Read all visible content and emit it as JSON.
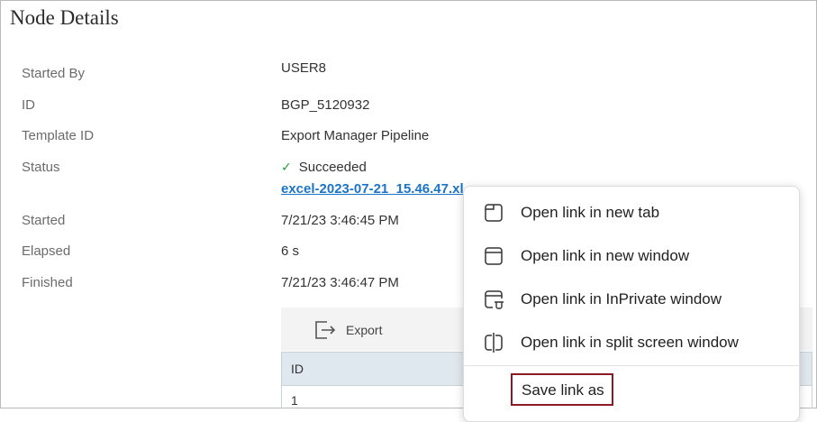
{
  "panel": {
    "title": "Node Details"
  },
  "details": [
    {
      "label": "Started By",
      "value": "USER8"
    },
    {
      "label": "ID",
      "value": "BGP_5120932"
    },
    {
      "label": "Template ID",
      "value": "Export Manager Pipeline"
    },
    {
      "label": "Status",
      "value": "Succeeded",
      "icon": "check-icon"
    },
    {
      "label": "Started",
      "value": "7/21/23 3:46:45 PM"
    },
    {
      "label": "Elapsed",
      "value": "6 s"
    },
    {
      "label": "Finished",
      "value": "7/21/23 3:46:47 PM"
    }
  ],
  "output_link": "excel-2023-07-21_15.46.47.xl",
  "toolbar": {
    "export_label": "Export",
    "export_icon": "export-icon"
  },
  "grid": {
    "header": "ID",
    "first_cell": "1",
    "header_color": "#dfe8ee"
  },
  "context_menu": {
    "items": [
      {
        "label": "Open link in new tab",
        "icon": "new-tab-icon"
      },
      {
        "label": "Open link in new window",
        "icon": "new-window-icon"
      },
      {
        "label": "Open link in InPrivate window",
        "icon": "inprivate-window-icon"
      },
      {
        "label": "Open link in split screen window",
        "icon": "split-screen-icon"
      },
      {
        "label": "Save link as",
        "icon": ""
      }
    ],
    "highlight_color": "#8b1a22"
  },
  "colors": {
    "link": "#1b74c5",
    "success": "#2e9b3f"
  }
}
